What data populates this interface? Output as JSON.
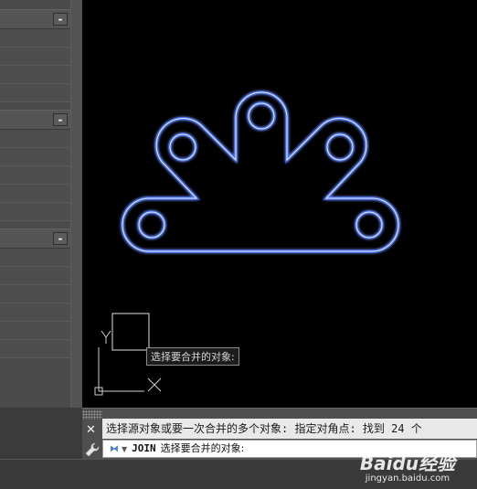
{
  "palette": {
    "sections": [
      {
        "collapse_label": "-"
      },
      {
        "collapse_label": "-"
      },
      {
        "collapse_label": "-"
      }
    ]
  },
  "canvas": {
    "background": "#000000",
    "object_outline_color": "#3f6fff",
    "ucs": {
      "y_label": "Y",
      "x_label": "X"
    },
    "cursor_tooltip": "选择要合并的对象:"
  },
  "command_line": {
    "close_icon": "close-icon",
    "history_text": "选择源对象或要一次合并的多个对象: 指定对角点: 找到 24 个",
    "prompt_icon": "command-prompt-icon",
    "command_name": "JOIN",
    "prompt_text": "选择要合并的对象:"
  },
  "watermark": {
    "brand": "Baidu经验",
    "site": "jingyan.baidu.com"
  }
}
